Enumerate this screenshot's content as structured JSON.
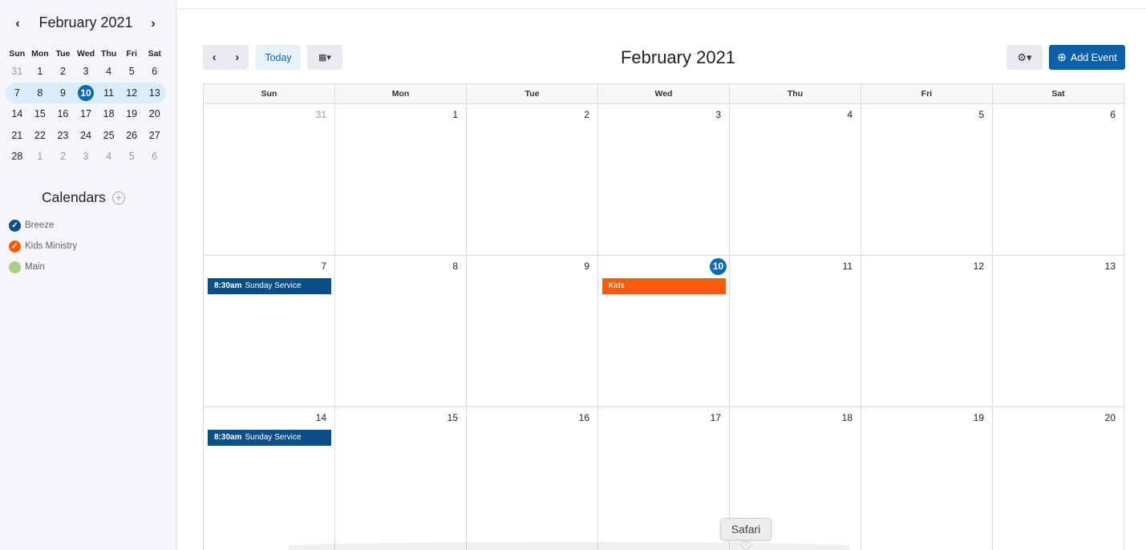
{
  "mini_calendar": {
    "title": "February 2021",
    "prev_icon": "‹",
    "next_icon": "›",
    "weekdays": [
      "Sun",
      "Mon",
      "Tue",
      "Wed",
      "Thu",
      "Fri",
      "Sat"
    ],
    "weeks": [
      [
        "31",
        "1",
        "2",
        "3",
        "4",
        "5",
        "6"
      ],
      [
        "7",
        "8",
        "9",
        "10",
        "11",
        "12",
        "13"
      ],
      [
        "14",
        "15",
        "16",
        "17",
        "18",
        "19",
        "20"
      ],
      [
        "21",
        "22",
        "23",
        "24",
        "25",
        "26",
        "27"
      ],
      [
        "28",
        "1",
        "2",
        "3",
        "4",
        "5",
        "6"
      ]
    ]
  },
  "calendars": {
    "title": "Calendars",
    "add_icon": "+",
    "items": [
      {
        "label": "Breeze",
        "color": "#0b4f86",
        "mark": "✓"
      },
      {
        "label": "Kids Ministry",
        "color": "#fe5a0c",
        "mark": "✓"
      },
      {
        "label": "Main",
        "color": "#a9cf86",
        "mark": ""
      }
    ]
  },
  "toolbar": {
    "prev_icon": "‹",
    "next_icon": "›",
    "today_label": "Today",
    "view_icon": "▦▾",
    "settings_icon": "⚙▾",
    "add_event_label": "Add Event",
    "add_event_icon": "⊕"
  },
  "page_title": "February 2021",
  "month": {
    "weekdays": [
      "Sun",
      "Mon",
      "Tue",
      "Wed",
      "Thu",
      "Fri",
      "Sat"
    ],
    "weeks": [
      [
        "31",
        "1",
        "2",
        "3",
        "4",
        "5",
        "6"
      ],
      [
        "7",
        "8",
        "9",
        "10",
        "11",
        "12",
        "13"
      ],
      [
        "14",
        "15",
        "16",
        "17",
        "18",
        "19",
        "20"
      ]
    ],
    "events": [
      {
        "week": 1,
        "day": 0,
        "time": "8:30am",
        "title": "Sunday Service",
        "color": "#0b4f86"
      },
      {
        "week": 1,
        "day": 3,
        "time": "",
        "title": "Kids",
        "color": "#fe5a0c"
      },
      {
        "week": 2,
        "day": 0,
        "time": "8:30am",
        "title": "Sunday Service",
        "color": "#0b4f86"
      }
    ]
  },
  "tooltip": "Safari"
}
